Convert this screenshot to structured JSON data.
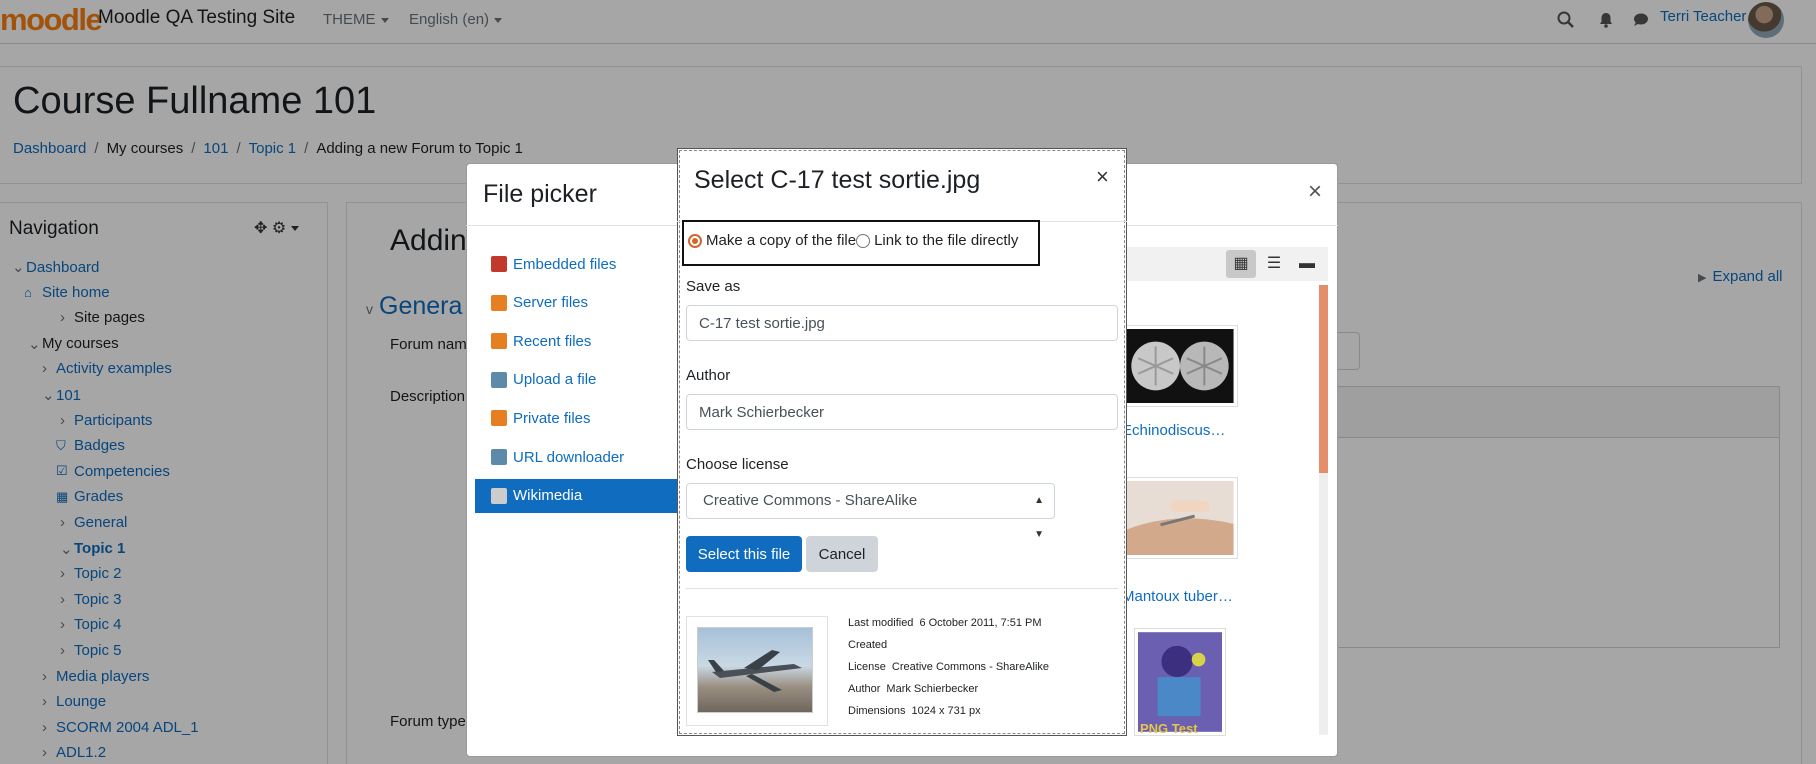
{
  "navbar": {
    "logo": "moodle",
    "site_name": "Moodle QA Testing Site",
    "theme_label": "THEME",
    "language_label": "English (en)",
    "user_name": "Terri Teacher"
  },
  "page": {
    "title": "Course Fullname 101",
    "breadcrumb": [
      "Dashboard",
      "My courses",
      "101",
      "Topic 1",
      "Adding a new Forum to Topic 1"
    ]
  },
  "navigation": {
    "title": "Navigation",
    "items": [
      {
        "label": "Dashboard",
        "chev": "v",
        "icon": ""
      },
      {
        "label": "Site home",
        "chev": "",
        "icon": "home"
      },
      {
        "label": "Site pages",
        "chev": ">",
        "icon": ""
      },
      {
        "label": "My courses",
        "chev": "v",
        "icon": ""
      },
      {
        "label": "Activity examples",
        "chev": ">",
        "icon": ""
      },
      {
        "label": "101",
        "chev": "v",
        "icon": ""
      },
      {
        "label": "Participants",
        "chev": ">",
        "icon": ""
      },
      {
        "label": "Badges",
        "chev": "",
        "icon": "shield"
      },
      {
        "label": "Competencies",
        "chev": "",
        "icon": "check"
      },
      {
        "label": "Grades",
        "chev": "",
        "icon": "table"
      },
      {
        "label": "General",
        "chev": ">",
        "icon": ""
      },
      {
        "label": "Topic 1",
        "chev": "v",
        "icon": ""
      },
      {
        "label": "Topic 2",
        "chev": ">",
        "icon": ""
      },
      {
        "label": "Topic 3",
        "chev": ">",
        "icon": ""
      },
      {
        "label": "Topic 4",
        "chev": ">",
        "icon": ""
      },
      {
        "label": "Topic 5",
        "chev": ">",
        "icon": ""
      },
      {
        "label": "Media players",
        "chev": ">",
        "icon": ""
      },
      {
        "label": "Lounge",
        "chev": ">",
        "icon": ""
      },
      {
        "label": "SCORM 2004 ADL_1",
        "chev": ">",
        "icon": ""
      },
      {
        "label": "ADL1.2",
        "chev": ">",
        "icon": ""
      }
    ]
  },
  "main": {
    "title_partial": "Addin",
    "general_partial": "Genera",
    "forum_name_label": "Forum nam",
    "description_label": "Description",
    "forum_type_label": "Forum type",
    "expand_all": "Expand all"
  },
  "file_picker": {
    "title": "File picker",
    "repositories": [
      {
        "label": "Embedded files",
        "color": "#c0392b"
      },
      {
        "label": "Server files",
        "color": "#e67e22"
      },
      {
        "label": "Recent files",
        "color": "#e67e22"
      },
      {
        "label": "Upload a file",
        "color": "#5d8aa8"
      },
      {
        "label": "Private files",
        "color": "#e67e22"
      },
      {
        "label": "URL downloader",
        "color": "#5d8aa8"
      },
      {
        "label": "Wikimedia",
        "color": "#cccccc"
      }
    ],
    "captions": [
      "Echinodiscus…",
      "Mantoux tuber…",
      "PNG Test"
    ]
  },
  "select_dialog": {
    "title": "Select C-17 test sortie.jpg",
    "radio_copy": "Make a copy of the file",
    "radio_link": "Link to the file directly",
    "save_as_label": "Save as",
    "save_as_value": "C-17 test sortie.jpg",
    "author_label": "Author",
    "author_value": "Mark Schierbecker",
    "license_label": "Choose license",
    "license_value": "Creative Commons - ShareAlike",
    "select_button": "Select this file",
    "cancel_button": "Cancel",
    "meta": [
      {
        "key": "Last modified",
        "value": "6 October 2011, 7:51 PM"
      },
      {
        "key": "Created",
        "value": ""
      },
      {
        "key": "License",
        "value": "Creative Commons - ShareAlike"
      },
      {
        "key": "Author",
        "value": "Mark Schierbecker"
      },
      {
        "key": "Dimensions",
        "value": "1024 x 731 px"
      }
    ]
  },
  "colors": {
    "brand": "#f98012",
    "primary": "#0f6cbf",
    "radio_accent": "#d2652d"
  }
}
